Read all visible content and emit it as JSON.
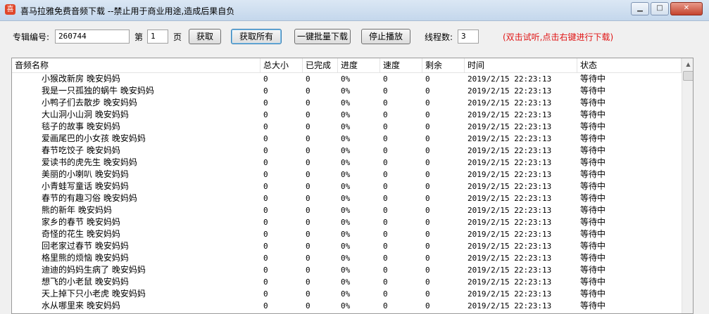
{
  "window": {
    "title": "喜马拉雅免费音频下载 --禁止用于商业用途,造成后果自负",
    "app_icon": "喜",
    "minimize": "▁",
    "maximize": "□",
    "close": "✕"
  },
  "toolbar": {
    "album_label": "专辑编号:",
    "album_value": "260744",
    "page_prefix": "第",
    "page_value": "1",
    "page_suffix": "页",
    "fetch_button": "获取",
    "fetch_all_button": "获取所有",
    "batch_download_button": "一键批量下载",
    "stop_play_button": "停止播放",
    "threads_label": "线程数:",
    "threads_value": "3",
    "hint": "(双击试听,点击右键进行下载)"
  },
  "list": {
    "columns": [
      "音频名称",
      "总大小",
      "已完成",
      "进度",
      "速度",
      "剩余",
      "时间",
      "状态"
    ],
    "rows": [
      {
        "name": "小猴改新房 晚安妈妈",
        "size": "0",
        "done": "0",
        "progress": "0%",
        "speed": "0",
        "remain": "0",
        "time": "2019/2/15 22:23:13",
        "status": "等待中"
      },
      {
        "name": "我是一只孤独的蜗牛 晚安妈妈",
        "size": "0",
        "done": "0",
        "progress": "0%",
        "speed": "0",
        "remain": "0",
        "time": "2019/2/15 22:23:13",
        "status": "等待中"
      },
      {
        "name": "小鸭子们去散步 晚安妈妈",
        "size": "0",
        "done": "0",
        "progress": "0%",
        "speed": "0",
        "remain": "0",
        "time": "2019/2/15 22:23:13",
        "status": "等待中"
      },
      {
        "name": "大山洞小山洞 晚安妈妈",
        "size": "0",
        "done": "0",
        "progress": "0%",
        "speed": "0",
        "remain": "0",
        "time": "2019/2/15 22:23:13",
        "status": "等待中"
      },
      {
        "name": "毯子的故事 晚安妈妈",
        "size": "0",
        "done": "0",
        "progress": "0%",
        "speed": "0",
        "remain": "0",
        "time": "2019/2/15 22:23:13",
        "status": "等待中"
      },
      {
        "name": "爱画尾巴的小女孩 晚安妈妈",
        "size": "0",
        "done": "0",
        "progress": "0%",
        "speed": "0",
        "remain": "0",
        "time": "2019/2/15 22:23:13",
        "status": "等待中"
      },
      {
        "name": "春节吃饺子 晚安妈妈",
        "size": "0",
        "done": "0",
        "progress": "0%",
        "speed": "0",
        "remain": "0",
        "time": "2019/2/15 22:23:13",
        "status": "等待中"
      },
      {
        "name": "爱读书的虎先生 晚安妈妈",
        "size": "0",
        "done": "0",
        "progress": "0%",
        "speed": "0",
        "remain": "0",
        "time": "2019/2/15 22:23:13",
        "status": "等待中"
      },
      {
        "name": "美丽的小喇叭 晚安妈妈",
        "size": "0",
        "done": "0",
        "progress": "0%",
        "speed": "0",
        "remain": "0",
        "time": "2019/2/15 22:23:13",
        "status": "等待中"
      },
      {
        "name": "小青蛙写童话 晚安妈妈",
        "size": "0",
        "done": "0",
        "progress": "0%",
        "speed": "0",
        "remain": "0",
        "time": "2019/2/15 22:23:13",
        "status": "等待中"
      },
      {
        "name": "春节的有趣习俗 晚安妈妈",
        "size": "0",
        "done": "0",
        "progress": "0%",
        "speed": "0",
        "remain": "0",
        "time": "2019/2/15 22:23:13",
        "status": "等待中"
      },
      {
        "name": "熊的新年 晚安妈妈",
        "size": "0",
        "done": "0",
        "progress": "0%",
        "speed": "0",
        "remain": "0",
        "time": "2019/2/15 22:23:13",
        "status": "等待中"
      },
      {
        "name": "家乡的春节 晚安妈妈",
        "size": "0",
        "done": "0",
        "progress": "0%",
        "speed": "0",
        "remain": "0",
        "time": "2019/2/15 22:23:13",
        "status": "等待中"
      },
      {
        "name": "奇怪的花生 晚安妈妈",
        "size": "0",
        "done": "0",
        "progress": "0%",
        "speed": "0",
        "remain": "0",
        "time": "2019/2/15 22:23:13",
        "status": "等待中"
      },
      {
        "name": "回老家过春节 晚安妈妈",
        "size": "0",
        "done": "0",
        "progress": "0%",
        "speed": "0",
        "remain": "0",
        "time": "2019/2/15 22:23:13",
        "status": "等待中"
      },
      {
        "name": "格里熊的烦恼 晚安妈妈",
        "size": "0",
        "done": "0",
        "progress": "0%",
        "speed": "0",
        "remain": "0",
        "time": "2019/2/15 22:23:13",
        "status": "等待中"
      },
      {
        "name": "迪迪的妈妈生病了 晚安妈妈",
        "size": "0",
        "done": "0",
        "progress": "0%",
        "speed": "0",
        "remain": "0",
        "time": "2019/2/15 22:23:13",
        "status": "等待中"
      },
      {
        "name": "想飞的小老鼠 晚安妈妈",
        "size": "0",
        "done": "0",
        "progress": "0%",
        "speed": "0",
        "remain": "0",
        "time": "2019/2/15 22:23:13",
        "status": "等待中"
      },
      {
        "name": "天上掉下只小老虎 晚安妈妈",
        "size": "0",
        "done": "0",
        "progress": "0%",
        "speed": "0",
        "remain": "0",
        "time": "2019/2/15 22:23:13",
        "status": "等待中"
      },
      {
        "name": "水从哪里来 晚安妈妈",
        "size": "0",
        "done": "0",
        "progress": "0%",
        "speed": "0",
        "remain": "0",
        "time": "2019/2/15 22:23:13",
        "status": "等待中"
      }
    ]
  },
  "scrollbar": {
    "up_arrow": "▲"
  }
}
